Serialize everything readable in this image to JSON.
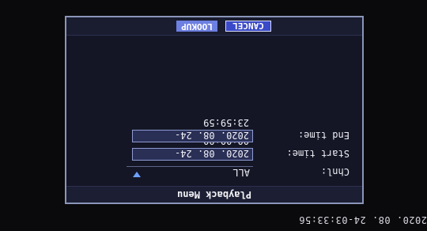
{
  "overlay": {
    "timestamp": "2020. 08. 24-03:33:56"
  },
  "menu": {
    "title": "Playback Menu",
    "fields": {
      "chnl_label": "Chnl:",
      "chnl_value": "ALL",
      "start_label": "Start time:",
      "start_value": "2020. 08. 24-00:00:00",
      "end_label": "End time:",
      "end_value": "2020. 08. 24-23:59:59"
    },
    "buttons": {
      "lookup_label": "LOOKUP",
      "cancel_label": "CANCEL"
    }
  },
  "display": {
    "orientation": "rotated-180",
    "accent_color": "#3a4ac8",
    "highlight_color": "#6d7fe0"
  }
}
